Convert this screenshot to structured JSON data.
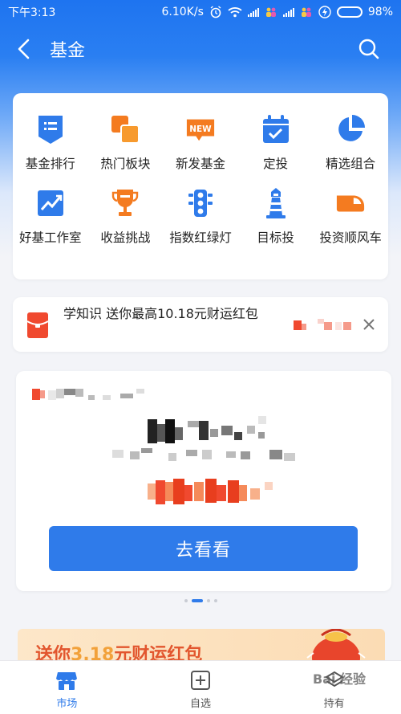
{
  "status_bar": {
    "time": "下午3:13",
    "speed": "6.10K/s",
    "battery": "98%",
    "battery_level": 0.98
  },
  "header": {
    "title": "基金"
  },
  "grid": {
    "items": [
      {
        "label": "基金排行",
        "icon": "list-badge-icon",
        "color": "#2f7bea"
      },
      {
        "label": "热门板块",
        "icon": "overlapping-squares-icon",
        "color": "#f47b20"
      },
      {
        "label": "新发基金",
        "icon": "new-badge-icon",
        "color": "#f47b20"
      },
      {
        "label": "定投",
        "icon": "calendar-check-icon",
        "color": "#2f7bea"
      },
      {
        "label": "精选组合",
        "icon": "pie-chart-icon",
        "color": "#2f7bea"
      },
      {
        "label": "好基工作室",
        "icon": "line-chart-icon",
        "color": "#2f7bea"
      },
      {
        "label": "收益挑战",
        "icon": "trophy-icon",
        "color": "#f47b20"
      },
      {
        "label": "指数红绿灯",
        "icon": "traffic-light-icon",
        "color": "#2f7bea"
      },
      {
        "label": "目标投",
        "icon": "lighthouse-icon",
        "color": "#2f7bea"
      },
      {
        "label": "投资顺风车",
        "icon": "train-icon",
        "color": "#f47b20"
      }
    ]
  },
  "banner": {
    "text": "学知识 送你最高10.18元财运红包",
    "icon": "red-envelope-icon"
  },
  "promo": {
    "button_label": "去看看"
  },
  "bottom_promo": {
    "prefix": "送你",
    "amount": "3.18",
    "suffix": "元财运红包"
  },
  "tabs": [
    {
      "label": "市场",
      "icon": "store-icon",
      "active": true
    },
    {
      "label": "自选",
      "icon": "add-square-icon",
      "active": false
    },
    {
      "label": "持有",
      "icon": "wallet-icon",
      "active": false
    }
  ],
  "watermark": "Bai 经验",
  "colors": {
    "accent": "#2f7bea",
    "orange": "#f47b20",
    "header_bg": "#1e74f0"
  }
}
